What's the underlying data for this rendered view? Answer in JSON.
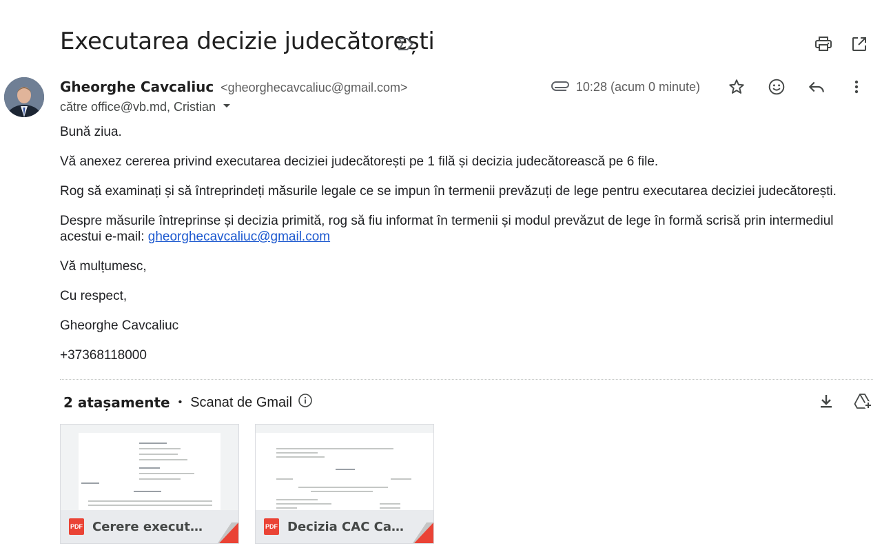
{
  "email": {
    "subject": "Executarea decizie judecătorești",
    "sender_name": "Gheorghe Cavcaliuc",
    "sender_email": "<gheorghecavcaliuc@gmail.com>",
    "recipients": "către office@vb.md, Cristian",
    "time": "10:28 (acum 0 minute)",
    "body": {
      "greeting": "Bună ziua.",
      "p1": "Vă anexez cererea privind executarea deciziei judecătorești pe 1 filă și decizia judecătorească pe 6 file.",
      "p2": "Rog să examinați și să întreprindeți măsurile legale ce se impun în termenii prevăzuți de lege pentru executarea deciziei judecătorești.",
      "p3": "Despre măsurile întreprinse și decizia primită, rog să fiu informat în termenii și modul prevăzut de lege în formă scrisă prin intermediul acestui e-mail: ",
      "p3_link": "gheorghecavcaliuc@gmail.com",
      "thanks": "Vă mulțumesc,",
      "regards": "Cu respect,",
      "signature_name": "Gheorghe Cavcaliuc",
      "phone": "+37368118000"
    }
  },
  "attachments": {
    "count_label": "2 atașamente",
    "separator": "•",
    "scan_label": "Scanat de Gmail",
    "files": [
      {
        "name": "Cerere executare decizie.pdf",
        "display": "Cerere executare ...",
        "type": "PDF"
      },
      {
        "name": "Decizia CAC Cavcaliuc.pdf",
        "display": "Decizia CAC Cavc...",
        "type": "PDF"
      }
    ]
  },
  "icons": {
    "print": "printer-icon",
    "open_new": "open-in-new-window-icon",
    "label": "label-icon",
    "attachment": "paperclip-icon",
    "star": "star-icon",
    "emoji": "emoji-icon",
    "reply": "reply-icon",
    "more": "more-vert-icon",
    "download": "download-icon",
    "drive": "add-to-drive-icon",
    "info": "info-icon",
    "expand": "chevron-down-icon"
  },
  "colors": {
    "link": "#1a57cf",
    "pdf_red": "#ea4335",
    "text": "#202124"
  }
}
